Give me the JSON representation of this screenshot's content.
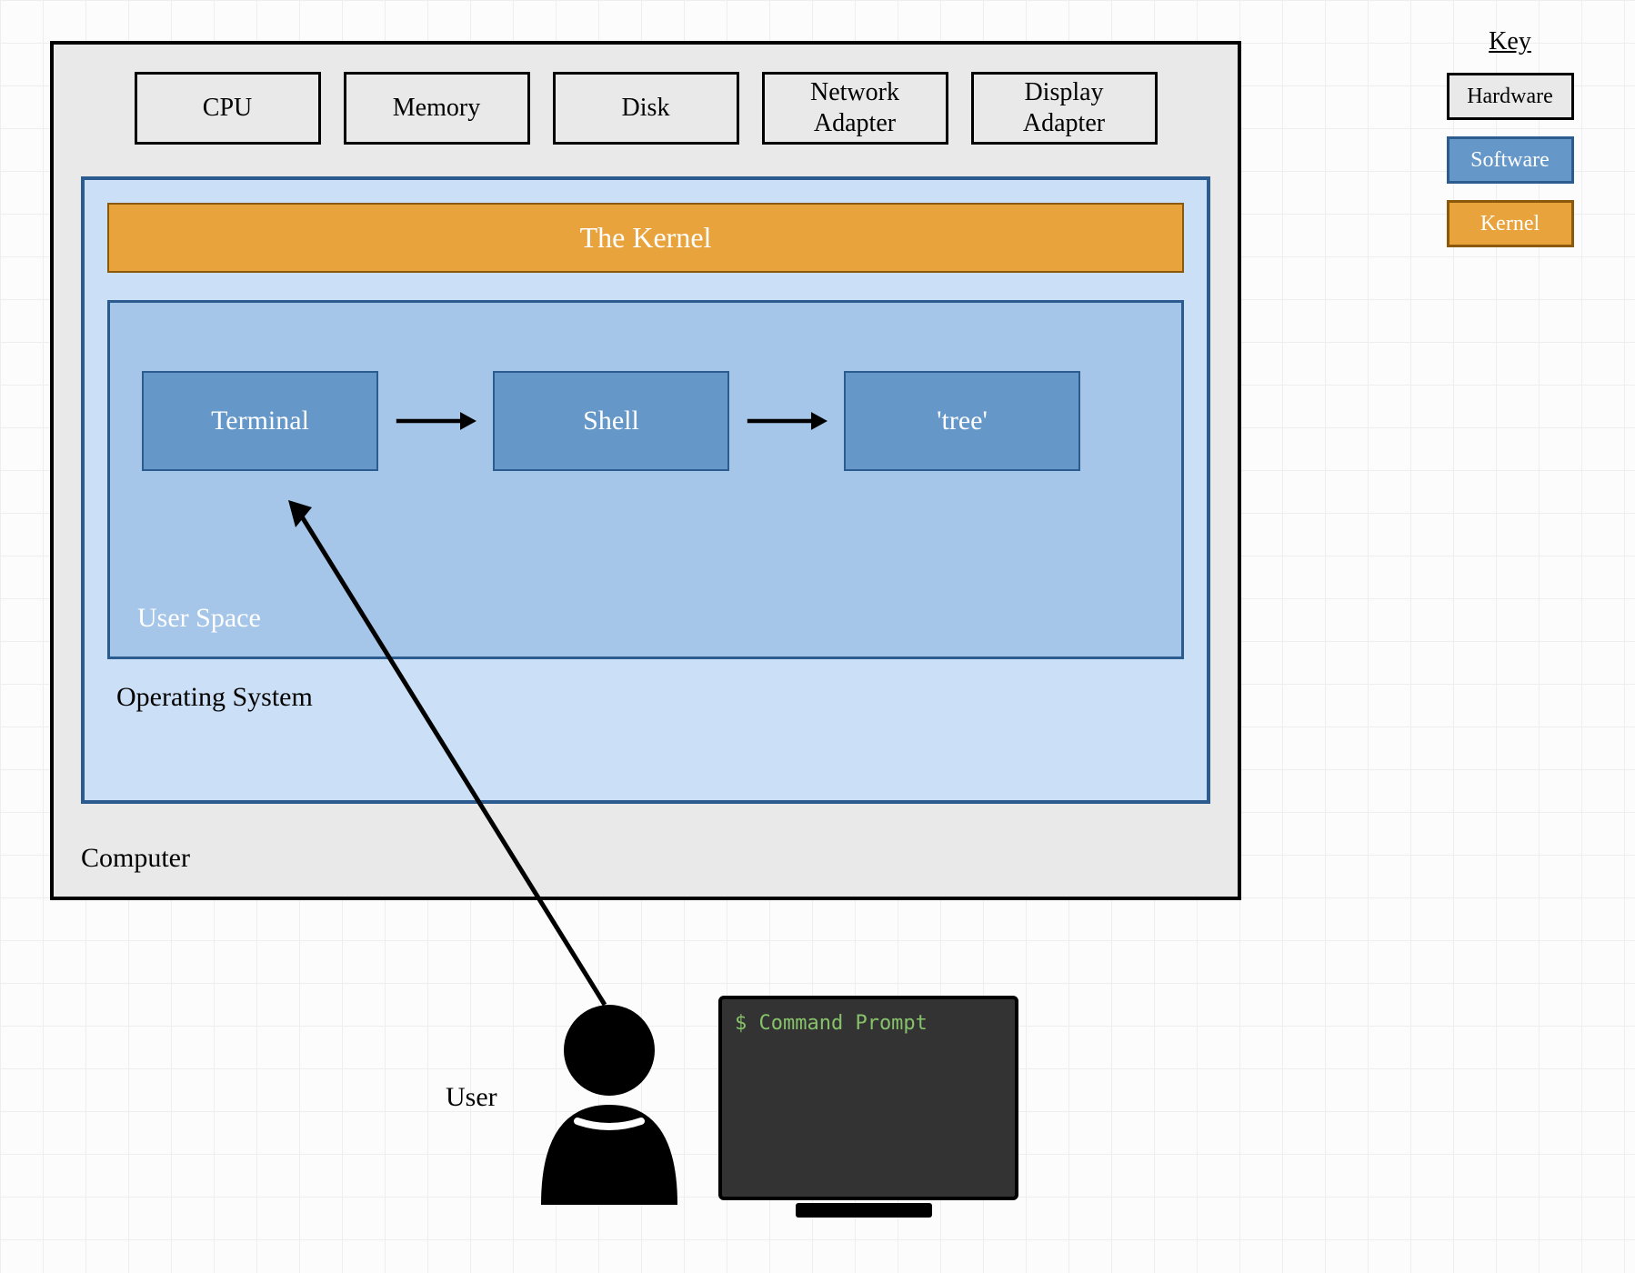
{
  "computer": {
    "label": "Computer",
    "hardware": [
      "CPU",
      "Memory",
      "Disk",
      "Network\nAdapter",
      "Display\nAdapter"
    ],
    "os": {
      "label": "Operating System",
      "kernel": "The Kernel",
      "userspace": {
        "label": "User Space",
        "items": [
          "Terminal",
          "Shell",
          "'tree'"
        ]
      }
    }
  },
  "legend": {
    "title": "Key",
    "items": [
      {
        "label": "Hardware",
        "kind": "hw"
      },
      {
        "label": "Software",
        "kind": "sw"
      },
      {
        "label": "Kernel",
        "kind": "kn"
      }
    ]
  },
  "user": {
    "label": "User",
    "prompt": "$ Command Prompt"
  },
  "colors": {
    "hardware_bg": "#e9e9e9",
    "software_bg": "#6598c9",
    "software_border": "#2b5b8f",
    "os_bg": "#cbe0f7",
    "kernel_bg": "#e8a33d",
    "kernel_border": "#8a5a0a",
    "terminal_text": "#86c26a"
  }
}
